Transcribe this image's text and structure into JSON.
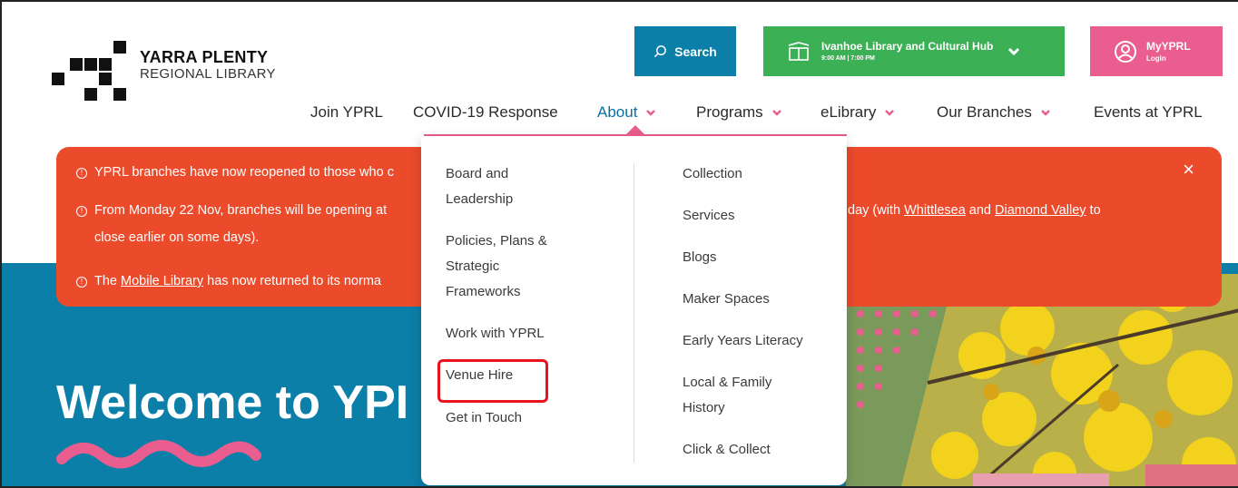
{
  "logo": {
    "line1": "YARRA PLENTY",
    "line2": "REGIONAL LIBRARY"
  },
  "header": {
    "search_label": "Search",
    "branch_name": "Ivanhoe Library and Cultural Hub",
    "branch_hours": "9:00 AM | 7:00 PM",
    "my_label": "MyYPRL",
    "my_sub": "Login"
  },
  "nav": [
    "Join YPRL",
    "COVID-19 Response",
    "About",
    "Programs",
    "eLibrary",
    "Our Branches",
    "Events at YPRL"
  ],
  "alert": {
    "line1": "YPRL branches have now reopened to those who c",
    "line2a": "From Monday 22 Nov, branches will be opening at",
    "line2b": "day (with",
    "whittlesea": "Whittlesea",
    "and": "and",
    "diamond_valley": "Diamond Valley",
    "to": "to",
    "line2c": "close earlier on some days).",
    "line3a": "The",
    "mobile_library": "Mobile Library",
    "line3b": "has now returned to its norma",
    "close": "×"
  },
  "dropdown": {
    "left": [
      "Board and",
      "Leadership",
      "Policies, Plans &",
      "Strategic",
      "Frameworks",
      "Work with YPRL",
      "Venue Hire",
      "Get in Touch"
    ],
    "right": [
      "Collection",
      "Services",
      "Blogs",
      "Maker Spaces",
      "Early Years Literacy",
      "Local & Family",
      "History",
      "Click & Collect"
    ]
  },
  "hero": {
    "title": "Welcome to YPI"
  },
  "colors": {
    "accent_blue": "#0b7fa8",
    "green": "#3cb055",
    "pink": "#ea5d8f",
    "alert": "#ec4b2b",
    "highlight": "#e8141b"
  }
}
